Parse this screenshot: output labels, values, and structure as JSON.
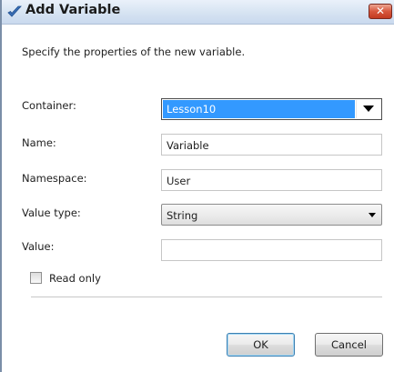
{
  "window": {
    "title": "Add Variable",
    "close_glyph": "✕",
    "title_icon": "checkmark-icon",
    "accent_color": "#3399ff"
  },
  "description": "Specify the properties of the new variable.",
  "fields": {
    "container": {
      "label": "Container:",
      "value": "Lesson10"
    },
    "name": {
      "label": "Name:",
      "value": "Variable"
    },
    "namespace": {
      "label": "Namespace:",
      "value": "User"
    },
    "value_type": {
      "label": "Value type:",
      "value": "String"
    },
    "value": {
      "label": "Value:",
      "value": ""
    }
  },
  "read_only": {
    "label": "Read only",
    "checked": false
  },
  "buttons": {
    "ok": "OK",
    "cancel": "Cancel"
  }
}
